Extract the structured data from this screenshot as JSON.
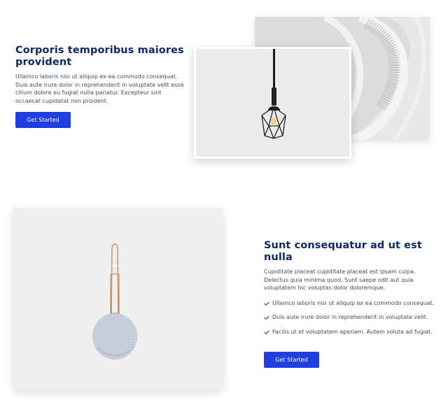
{
  "section1": {
    "title": "Corporis temporibus maiores provident",
    "body": "Ullamco laboris nisi ut aliquip ex ea commodo consequat. Duis aute irure dolor in reprehenderit in voluptate velit esse cillum dolore eu fugiat nulla pariatur. Excepteur sint occaecat cupidatat non proident.",
    "button_label": "Get Started"
  },
  "section2": {
    "title": "Sunt consequatur ad ut est nulla",
    "body": "Cupiditate placeat cupiditate placeat est ipsam culpa. Delectus quia minima quod. Sunt saepe odit aut quia voluptatem hic voluptas dolor doloremque.",
    "features": [
      "Ullamco laboris nisi ut aliquip ex ea commodo consequat.",
      "Duis aute irure dolor in reprehenderit in voluptate velit.",
      "Facilis ut et voluptatem aperiam. Autem soluta ad fugiat."
    ],
    "button_label": "Get Started"
  },
  "icons": {
    "feature_bullet": "check-icon"
  },
  "colors": {
    "heading": "#0d2b66",
    "accent": "#1f3fe0",
    "text": "#444b55"
  }
}
